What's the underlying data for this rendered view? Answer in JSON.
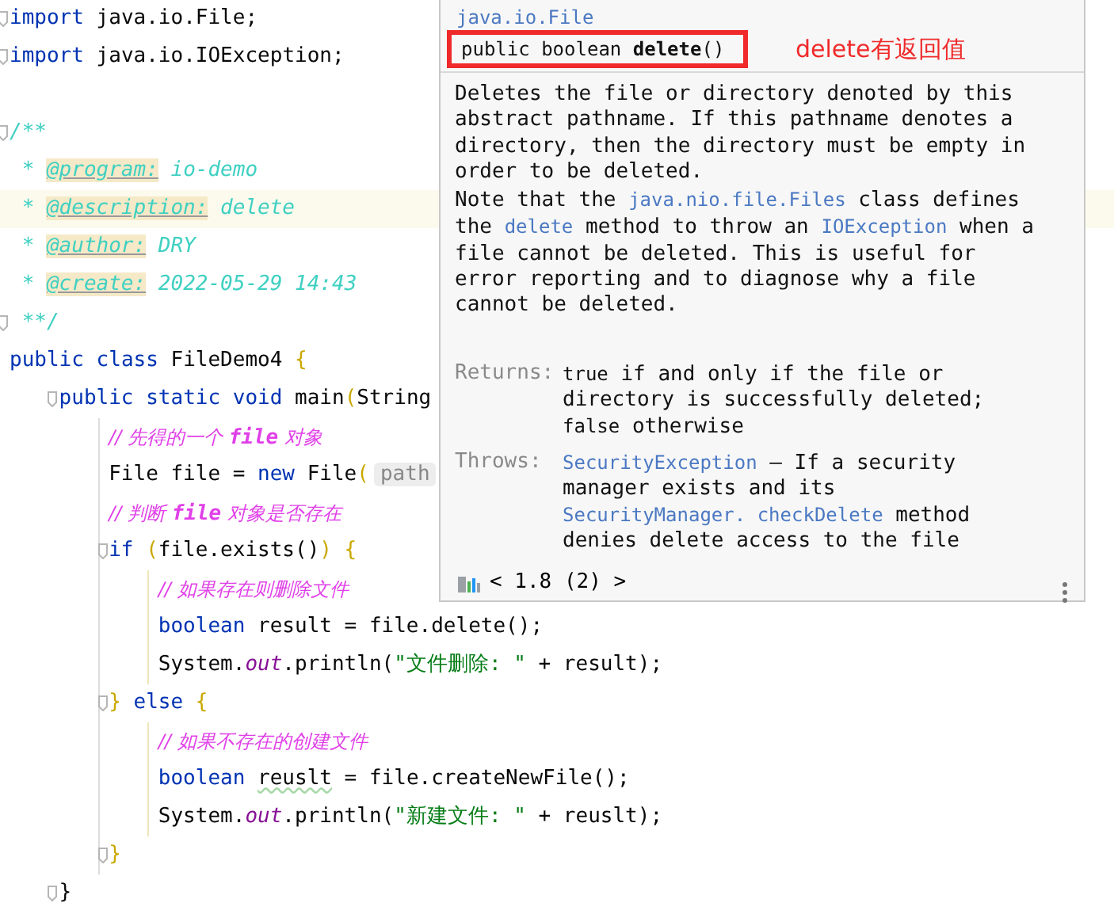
{
  "editor": {
    "lines": [
      {
        "fold": true,
        "current": false,
        "tokens": [
          {
            "kind": "kw",
            "text": "import"
          },
          {
            "kind": "plain",
            "text": " java.io.File;"
          }
        ]
      },
      {
        "fold": true,
        "current": false,
        "tokens": [
          {
            "kind": "kw",
            "text": "import"
          },
          {
            "kind": "plain",
            "text": " java.io.IOException;"
          }
        ]
      },
      {
        "current": false
      },
      {
        "fold": true,
        "current": false,
        "tokens": [
          {
            "kind": "doc",
            "text": "/**"
          }
        ]
      },
      {
        "current": false,
        "doc_indent": true,
        "tokens": [
          {
            "kind": "doc",
            "text": "* "
          },
          {
            "kind": "doctag",
            "text": "@program:"
          },
          {
            "kind": "doc",
            "text": " io-demo"
          }
        ]
      },
      {
        "current": true,
        "doc_indent": true,
        "tokens": [
          {
            "kind": "doc",
            "text": "* "
          },
          {
            "kind": "doctag",
            "text": "@description:"
          },
          {
            "kind": "doc",
            "text": " delete"
          }
        ]
      },
      {
        "current": false,
        "doc_indent": true,
        "tokens": [
          {
            "kind": "doc",
            "text": "* "
          },
          {
            "kind": "doctag",
            "text": "@author:"
          },
          {
            "kind": "doc",
            "text": " DRY"
          }
        ]
      },
      {
        "current": false,
        "doc_indent": true,
        "tokens": [
          {
            "kind": "doc",
            "text": "* "
          },
          {
            "kind": "doctag",
            "text": "@create:"
          },
          {
            "kind": "doc",
            "text": " 2022-05-29 14:43"
          }
        ]
      },
      {
        "fold": true,
        "current": false,
        "doc_indent": true,
        "tokens": [
          {
            "kind": "doc",
            "text": "**/"
          }
        ]
      },
      {
        "current": false,
        "tokens": [
          {
            "kind": "kw",
            "text": "public class"
          },
          {
            "kind": "plain",
            "text": " FileDemo4 "
          },
          {
            "kind": "brace",
            "text": "{"
          }
        ],
        "children": [
          {
            "fold": true,
            "current": false,
            "tokens": [
              {
                "kind": "kw",
                "text": "public static void"
              },
              {
                "kind": "plain",
                "text": " main"
              },
              {
                "kind": "brace",
                "text": "("
              },
              {
                "kind": "plain",
                "text": "String"
              }
            ],
            "children": [
              {
                "current": false,
                "tokens": [
                  {
                    "kind": "comment",
                    "text": "// 先得的一个 "
                  },
                  {
                    "kind": "commentbold",
                    "text": "file"
                  },
                  {
                    "kind": "comment",
                    "text": " 对象"
                  }
                ]
              },
              {
                "current": false,
                "tokens": [
                  {
                    "kind": "plain",
                    "text": "File file = "
                  },
                  {
                    "kind": "kw",
                    "text": "new"
                  },
                  {
                    "kind": "plain",
                    "text": " File"
                  },
                  {
                    "kind": "brace",
                    "text": "("
                  },
                  {
                    "kind": "inlay",
                    "text": "path"
                  }
                ]
              },
              {
                "current": false,
                "tokens": [
                  {
                    "kind": "comment",
                    "text": "// 判断 "
                  },
                  {
                    "kind": "commentbold",
                    "text": "file"
                  },
                  {
                    "kind": "comment",
                    "text": " 对象是否存在"
                  }
                ]
              },
              {
                "fold": true,
                "current": false,
                "tokens": [
                  {
                    "kind": "kw",
                    "text": "if "
                  },
                  {
                    "kind": "brace",
                    "text": "("
                  },
                  {
                    "kind": "plain",
                    "text": "file.exists()"
                  },
                  {
                    "kind": "brace",
                    "text": ") {"
                  }
                ],
                "children": [
                  {
                    "current": false,
                    "tokens": [
                      {
                        "kind": "comment",
                        "text": "// 如果存在则删除文件"
                      }
                    ]
                  },
                  {
                    "current": false,
                    "tokens": [
                      {
                        "kind": "kw",
                        "text": "boolean"
                      },
                      {
                        "kind": "plain",
                        "text": " result = file.delete();"
                      }
                    ]
                  },
                  {
                    "current": false,
                    "tokens": [
                      {
                        "kind": "plain",
                        "text": "System."
                      },
                      {
                        "kind": "field",
                        "text": "out"
                      },
                      {
                        "kind": "plain",
                        "text": ".println("
                      },
                      {
                        "kind": "string",
                        "text": "\"文件删除: \""
                      },
                      {
                        "kind": "plain",
                        "text": " + result);"
                      }
                    ]
                  }
                ]
              },
              {
                "fold": true,
                "current": false,
                "tokens": [
                  {
                    "kind": "brace",
                    "text": "}"
                  },
                  {
                    "kind": "kw",
                    "text": " else "
                  },
                  {
                    "kind": "brace",
                    "text": "{"
                  }
                ],
                "children": [
                  {
                    "current": false,
                    "tokens": [
                      {
                        "kind": "comment",
                        "text": "// 如果不存在的创建文件"
                      }
                    ]
                  },
                  {
                    "current": false,
                    "tokens": [
                      {
                        "kind": "kw",
                        "text": "boolean "
                      },
                      {
                        "kind": "typo",
                        "text": "reuslt"
                      },
                      {
                        "kind": "plain",
                        "text": " = file.createNewFile();"
                      }
                    ]
                  },
                  {
                    "current": false,
                    "tokens": [
                      {
                        "kind": "plain",
                        "text": "System."
                      },
                      {
                        "kind": "field",
                        "text": "out"
                      },
                      {
                        "kind": "plain",
                        "text": ".println("
                      },
                      {
                        "kind": "string",
                        "text": "\"新建文件: \""
                      },
                      {
                        "kind": "plain",
                        "text": " + reuslt);"
                      }
                    ]
                  }
                ]
              },
              {
                "fold": true,
                "current": false,
                "tokens": [
                  {
                    "kind": "brace",
                    "text": "}"
                  }
                ]
              }
            ]
          },
          {
            "fold": true,
            "current": false,
            "tokens": [
              {
                "kind": "plain",
                "text": "}"
              }
            ]
          }
        ]
      }
    ]
  },
  "doc_popup": {
    "class_link": "java.io.File",
    "signature": [
      {
        "kind": "text",
        "text": "public boolean "
      },
      {
        "kind": "bold",
        "text": "delete"
      },
      {
        "kind": "text",
        "text": "()"
      }
    ],
    "annotation": "delete有返回值",
    "description": [
      [
        {
          "kind": "text",
          "text": "Deletes the file or directory denoted by this abstract pathname. If this pathname denotes a directory, then the directory must be empty in order to be deleted."
        }
      ],
      [
        {
          "kind": "text",
          "text": "Note that the "
        },
        {
          "kind": "link",
          "text": "java.nio.file.Files"
        },
        {
          "kind": "text",
          "text": " class defines the "
        },
        {
          "kind": "link",
          "text": "delete"
        },
        {
          "kind": "text",
          "text": " method to throw an "
        },
        {
          "kind": "link",
          "text": "IOException"
        },
        {
          "kind": "text",
          "text": " when a file cannot be deleted. This is useful for error reporting and to diagnose why a file cannot be deleted."
        }
      ]
    ],
    "sections": [
      {
        "label": "Returns:",
        "body": [
          {
            "kind": "code",
            "text": "true"
          },
          {
            "kind": "text",
            "text": " if and only if the file or directory is successfully deleted; "
          },
          {
            "kind": "code",
            "text": "false"
          },
          {
            "kind": "text",
            "text": " otherwise"
          }
        ]
      },
      {
        "label": "Throws:",
        "body": [
          {
            "kind": "link",
            "text": "SecurityException"
          },
          {
            "kind": "text",
            "text": " – If a security manager exists and its "
          },
          {
            "kind": "link",
            "text": "SecurityManager. checkDelete"
          },
          {
            "kind": "text",
            "text": " method denies delete access to the file"
          }
        ]
      }
    ],
    "version": "< 1.8 (2) >"
  }
}
